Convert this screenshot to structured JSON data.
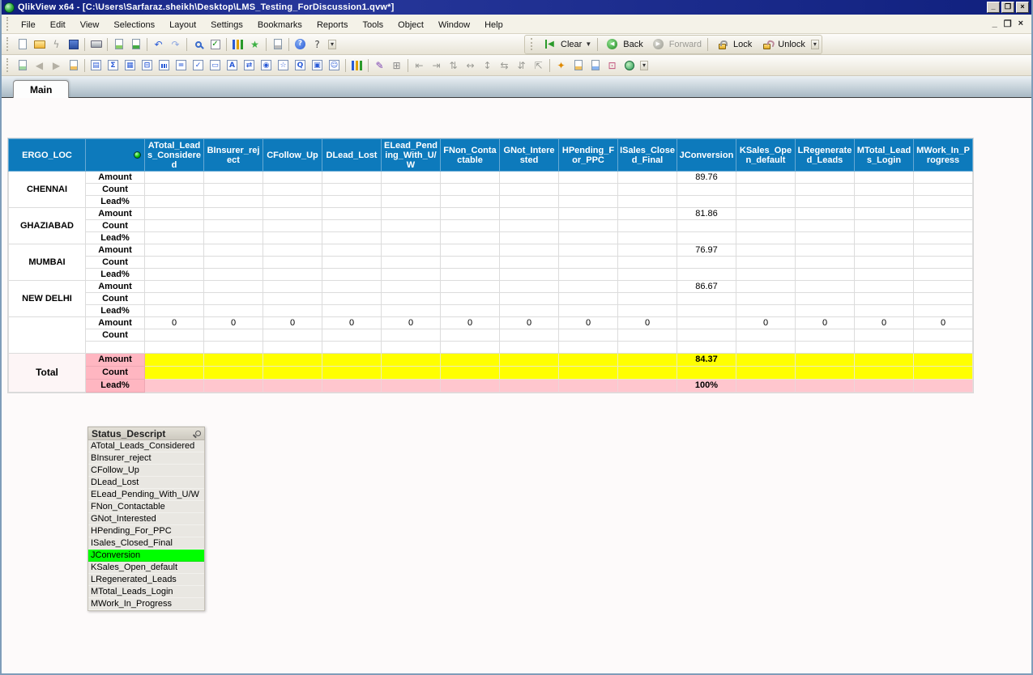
{
  "window": {
    "title": "QlikView x64 - [C:\\Users\\Sarfaraz.sheikh\\Desktop\\LMS_Testing_ForDiscussion1.qvw*]",
    "controls": {
      "minimize": "_",
      "restore": "❐",
      "close": "×"
    },
    "mdi_controls": {
      "minimize": "_",
      "restore": "❐",
      "close": "×"
    }
  },
  "menu": {
    "items": [
      "File",
      "Edit",
      "View",
      "Selections",
      "Layout",
      "Settings",
      "Bookmarks",
      "Reports",
      "Tools",
      "Object",
      "Window",
      "Help"
    ]
  },
  "toolbar1": {
    "icons": [
      {
        "n": "new-document-icon",
        "k": "page"
      },
      {
        "n": "open-file-icon",
        "k": "folder"
      },
      {
        "n": "reload-data-icon",
        "k": "glyph",
        "g": "ϟ",
        "c": "#9a9a94"
      },
      {
        "n": "save-icon",
        "k": "floppy"
      },
      {
        "n": "sep"
      },
      {
        "n": "print-icon",
        "k": "printer"
      },
      {
        "n": "sep"
      },
      {
        "n": "edit-sheet-icon",
        "k": "note",
        "c": "#8c6"
      },
      {
        "n": "export-icon",
        "k": "note",
        "c": "#4a4"
      },
      {
        "n": "sep"
      },
      {
        "n": "undo-icon",
        "k": "glyph",
        "g": "↶",
        "c": "#2a5bd7"
      },
      {
        "n": "redo-icon",
        "k": "glyph",
        "g": "↷",
        "c": "#8fa8e0"
      },
      {
        "n": "sep"
      },
      {
        "n": "zoom-icon",
        "k": "magnifier"
      },
      {
        "n": "current-selections-icon",
        "k": "checkbox"
      },
      {
        "n": "sep"
      },
      {
        "n": "quick-chart-wizard-icon",
        "k": "bars"
      },
      {
        "n": "add-bookmark-icon",
        "k": "glyph",
        "g": "★",
        "c": "#3cb043"
      },
      {
        "n": "sep"
      },
      {
        "n": "edit-note-icon",
        "k": "note",
        "c": "#bbb"
      },
      {
        "n": "sep"
      },
      {
        "n": "help-icon",
        "k": "help"
      },
      {
        "n": "whats-this-icon",
        "k": "glyph",
        "g": "?",
        "c": "#444"
      }
    ],
    "clear_label": "Clear",
    "back_label": "Back",
    "forward_label": "Forward",
    "lock_label": "Lock",
    "unlock_label": "Unlock"
  },
  "toolbar2": {
    "icons": [
      {
        "n": "add-sheet-icon",
        "k": "note",
        "c": "#9fd6a0"
      },
      {
        "n": "promote-sheet-icon",
        "k": "glyph",
        "g": "◀",
        "c": "#b4b0a4"
      },
      {
        "n": "demote-sheet-icon",
        "k": "glyph",
        "g": "▶",
        "c": "#b4b0a4"
      },
      {
        "n": "sheet-properties-icon",
        "k": "note",
        "c": "#f0c060"
      },
      {
        "n": "sep"
      },
      {
        "n": "create-listbox-icon",
        "k": "obj",
        "g": "▤"
      },
      {
        "n": "create-statistics-box-icon",
        "k": "obj",
        "g": "Σ"
      },
      {
        "n": "create-table-box-icon",
        "k": "obj",
        "g": "▦"
      },
      {
        "n": "create-input-box-icon",
        "k": "obj",
        "g": "⊟"
      },
      {
        "n": "create-chart-icon",
        "k": "obj-bars"
      },
      {
        "n": "create-current-selections-box-icon",
        "k": "obj",
        "g": "="
      },
      {
        "n": "create-multi-box-icon",
        "k": "obj",
        "g": "✓"
      },
      {
        "n": "create-button-icon",
        "k": "obj",
        "g": "▭"
      },
      {
        "n": "create-text-object-icon",
        "k": "obj",
        "g": "A"
      },
      {
        "n": "create-slider-icon",
        "k": "obj",
        "g": "⇄"
      },
      {
        "n": "create-bookmark-object-icon",
        "k": "obj",
        "g": "◉"
      },
      {
        "n": "create-search-object-icon",
        "k": "obj",
        "g": "☆"
      },
      {
        "n": "search-object-icon",
        "k": "obj",
        "g": "Q"
      },
      {
        "n": "create-container-icon",
        "k": "obj",
        "g": "▣"
      },
      {
        "n": "create-custom-object-icon",
        "k": "obj",
        "g": "☺"
      },
      {
        "n": "sep"
      },
      {
        "n": "chart-wizard-icon",
        "k": "bars"
      },
      {
        "n": "sep"
      },
      {
        "n": "format-painter-icon",
        "k": "glyph",
        "g": "✎",
        "c": "#7a3fb0"
      },
      {
        "n": "design-grid-icon",
        "k": "glyph",
        "g": "⊞",
        "c": "#888"
      },
      {
        "n": "sep"
      },
      {
        "n": "align-left-icon",
        "k": "glyph",
        "g": "⇤",
        "c": "#9a9a94"
      },
      {
        "n": "align-right-icon",
        "k": "glyph",
        "g": "⇥",
        "c": "#9a9a94"
      },
      {
        "n": "align-top-icon",
        "k": "glyph",
        "g": "⇅",
        "c": "#9a9a94"
      },
      {
        "n": "space-horizontally-icon",
        "k": "glyph",
        "g": "↔",
        "c": "#9a9a94"
      },
      {
        "n": "space-vertically-icon",
        "k": "glyph",
        "g": "↕",
        "c": "#9a9a94"
      },
      {
        "n": "adjust-left-icon",
        "k": "glyph",
        "g": "⇆",
        "c": "#9a9a94"
      },
      {
        "n": "adjust-top-icon",
        "k": "glyph",
        "g": "⇵",
        "c": "#9a9a94"
      },
      {
        "n": "snap-grid-icon",
        "k": "glyph",
        "g": "⇱",
        "c": "#9a9a94"
      },
      {
        "n": "sep"
      },
      {
        "n": "theme-maker-icon",
        "k": "glyph",
        "g": "✦",
        "c": "#e08a00"
      },
      {
        "n": "add-note-icon",
        "k": "note",
        "c": "#f0c060"
      },
      {
        "n": "edit-module-icon",
        "k": "note",
        "c": "#88b4f0"
      },
      {
        "n": "expression-overview-icon",
        "k": "glyph",
        "g": "⊡",
        "c": "#c0507a"
      },
      {
        "n": "web-view-icon",
        "k": "globe"
      }
    ]
  },
  "tabs": [
    {
      "label": "Main"
    }
  ],
  "pivot": {
    "corner": "ERGO_LOC",
    "sort_indicator": "green-dot",
    "columns": [
      "ATotal_Leads_Considered",
      "BInsurer_reject",
      "CFollow_Up",
      "DLead_Lost",
      "ELead_Pending_With_U/W",
      "FNon_Contactable",
      "GNot_Interested",
      "HPending_For_PPC",
      "ISales_Closed_Final",
      "JConversion",
      "KSales_Open_default",
      "LRegenerated_Leads",
      "MTotal_Leads_Login",
      "MWork_In_Progress"
    ],
    "groups": [
      {
        "name": "CHENNAI",
        "rows": [
          {
            "label": "Amount",
            "values": [
              "",
              "",
              "",
              "",
              "",
              "",
              "",
              "",
              "",
              "89.76",
              "",
              "",
              "",
              ""
            ]
          },
          {
            "label": "Count",
            "values": [
              "",
              "",
              "",
              "",
              "",
              "",
              "",
              "",
              "",
              "",
              "",
              "",
              "",
              ""
            ]
          },
          {
            "label": "Lead%",
            "values": [
              "",
              "",
              "",
              "",
              "",
              "",
              "",
              "",
              "",
              "",
              "",
              "",
              "",
              ""
            ]
          }
        ]
      },
      {
        "name": "GHAZIABAD",
        "rows": [
          {
            "label": "Amount",
            "values": [
              "",
              "",
              "",
              "",
              "",
              "",
              "",
              "",
              "",
              "81.86",
              "",
              "",
              "",
              ""
            ]
          },
          {
            "label": "Count",
            "values": [
              "",
              "",
              "",
              "",
              "",
              "",
              "",
              "",
              "",
              "",
              "",
              "",
              "",
              ""
            ]
          },
          {
            "label": "Lead%",
            "values": [
              "",
              "",
              "",
              "",
              "",
              "",
              "",
              "",
              "",
              "",
              "",
              "",
              "",
              ""
            ]
          }
        ]
      },
      {
        "name": "MUMBAI",
        "rows": [
          {
            "label": "Amount",
            "values": [
              "",
              "",
              "",
              "",
              "",
              "",
              "",
              "",
              "",
              "76.97",
              "",
              "",
              "",
              ""
            ]
          },
          {
            "label": "Count",
            "values": [
              "",
              "",
              "",
              "",
              "",
              "",
              "",
              "",
              "",
              "",
              "",
              "",
              "",
              ""
            ]
          },
          {
            "label": "Lead%",
            "values": [
              "",
              "",
              "",
              "",
              "",
              "",
              "",
              "",
              "",
              "",
              "",
              "",
              "",
              ""
            ]
          }
        ]
      },
      {
        "name": "NEW DELHI",
        "rows": [
          {
            "label": "Amount",
            "values": [
              "",
              "",
              "",
              "",
              "",
              "",
              "",
              "",
              "",
              "86.67",
              "",
              "",
              "",
              ""
            ]
          },
          {
            "label": "Count",
            "values": [
              "",
              "",
              "",
              "",
              "",
              "",
              "",
              "",
              "",
              "",
              "",
              "",
              "",
              ""
            ]
          },
          {
            "label": "Lead%",
            "values": [
              "",
              "",
              "",
              "",
              "",
              "",
              "",
              "",
              "",
              "",
              "",
              "",
              "",
              ""
            ]
          }
        ]
      },
      {
        "name": "",
        "rows": [
          {
            "label": "Amount",
            "values": [
              "0",
              "0",
              "0",
              "0",
              "0",
              "0",
              "0",
              "0",
              "0",
              "",
              "0",
              "0",
              "0",
              "0"
            ]
          },
          {
            "label": "Count",
            "values": [
              "",
              "",
              "",
              "",
              "",
              "",
              "",
              "",
              "",
              "",
              "",
              "",
              "",
              ""
            ]
          },
          {
            "label": "",
            "values": [
              "",
              "",
              "",
              "",
              "",
              "",
              "",
              "",
              "",
              "",
              "",
              "",
              "",
              ""
            ]
          }
        ]
      },
      {
        "name": "Total",
        "total": true,
        "rows": [
          {
            "label": "Amount",
            "style": "yellow",
            "values": [
              "",
              "",
              "",
              "",
              "",
              "",
              "",
              "",
              "",
              "84.37",
              "",
              "",
              "",
              ""
            ]
          },
          {
            "label": "Count",
            "style": "yellow",
            "values": [
              "",
              "",
              "",
              "",
              "",
              "",
              "",
              "",
              "",
              "",
              "",
              "",
              "",
              ""
            ]
          },
          {
            "label": "Lead%",
            "style": "pink",
            "values": [
              "",
              "",
              "",
              "",
              "",
              "",
              "",
              "",
              "",
              "100%",
              "",
              "",
              "",
              ""
            ]
          }
        ]
      }
    ],
    "colors": {
      "header_bg": "#0d7abc",
      "total_yellow": "#ffff00",
      "total_pink": "#ffc6ce",
      "total_label_pink": "#ffb6c1"
    }
  },
  "listbox": {
    "title": "Status_Descript",
    "search_icon": "magnifier",
    "selected": "JConversion",
    "selected_color": "#00ff00",
    "items": [
      "ATotal_Leads_Considered",
      "BInsurer_reject",
      "CFollow_Up",
      "DLead_Lost",
      "ELead_Pending_With_U/W",
      "FNon_Contactable",
      "GNot_Interested",
      "HPending_For_PPC",
      "ISales_Closed_Final",
      "JConversion",
      "KSales_Open_default",
      "LRegenerated_Leads",
      "MTotal_Leads_Login",
      "MWork_In_Progress"
    ]
  }
}
